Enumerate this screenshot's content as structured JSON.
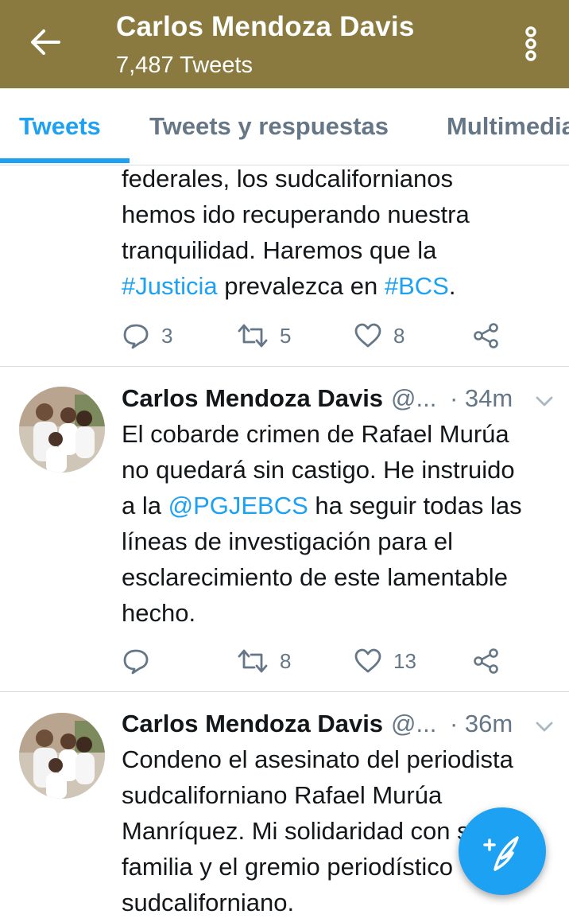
{
  "header": {
    "title": "Carlos Mendoza Davis",
    "subtitle": "7,487 Tweets",
    "background": "#8a7a3f"
  },
  "tabs": [
    {
      "label": "Tweets",
      "active": true
    },
    {
      "label": "Tweets y respuestas",
      "active": false
    },
    {
      "label": "Multimedia",
      "active": false
    }
  ],
  "tweets": [
    {
      "partial": true,
      "text_lines": [
        "federales, los sudcalifornianos",
        "hemos ido recuperando nuestra",
        "tranquilidad. Haremos que la"
      ],
      "hashtag1": "#Justicia",
      "middle": " prevalezca en ",
      "hashtag2": "#BCS",
      "end": ".",
      "replies": "3",
      "retweets": "5",
      "likes": "8"
    },
    {
      "name": "Carlos Mendoza Davis",
      "handle": "@...",
      "time": "· 34m",
      "line1": "El cobarde crimen de Rafael Murúa",
      "line2": "no quedará sin castigo. He instruido",
      "line3_pre": "a la ",
      "mention": "@PGJEBCS",
      "line3_post": " ha seguir  todas las",
      "line4": "líneas de investigación para el",
      "line5": "esclarecimiento de este lamentable",
      "line6": "hecho.",
      "replies": "",
      "retweets": "8",
      "likes": "13"
    },
    {
      "name": "Carlos Mendoza Davis",
      "handle": "@...",
      "time": "· 36m",
      "line1": "Condeno el asesinato del periodista",
      "line2": "sudcaliforniano Rafael Murúa",
      "line3": "Manríquez. Mi solidaridad con su",
      "line4": "familia y el gremio periodístico",
      "line5": "sudcaliforniano."
    }
  ],
  "icons": {
    "back": "arrow-left-icon",
    "more": "more-vertical-icon",
    "reply": "reply-icon",
    "retweet": "retweet-icon",
    "like": "heart-icon",
    "share": "share-icon",
    "compose": "compose-tweet-icon"
  },
  "colors": {
    "accent": "#1da1f2",
    "text": "#14171a",
    "secondary": "#657786"
  }
}
